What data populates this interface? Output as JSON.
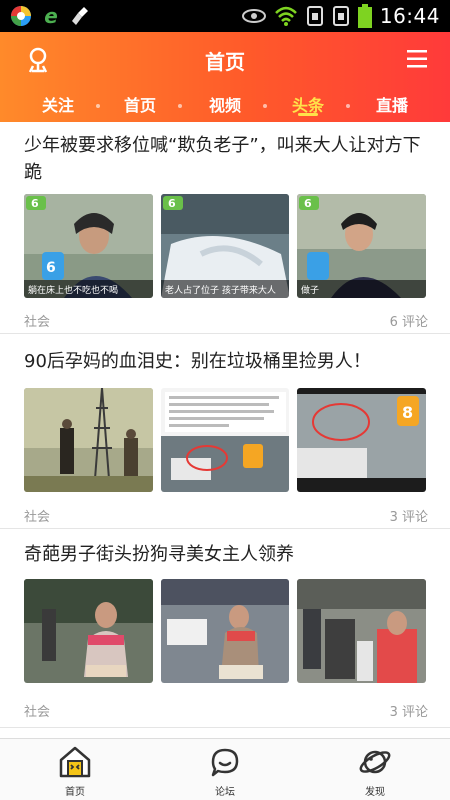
{
  "status_bar": {
    "time": "16:44",
    "icons": [
      "browser-icon",
      "edge-icon",
      "broom-icon",
      "eye-icon",
      "wifi-icon",
      "sim-icon",
      "sim-icon",
      "battery-icon"
    ]
  },
  "header": {
    "title": "首页",
    "tabs": [
      {
        "label": "关注",
        "active": false
      },
      {
        "label": "首页",
        "active": false
      },
      {
        "label": "视频",
        "active": false
      },
      {
        "label": "头条",
        "active": true
      },
      {
        "label": "直播",
        "active": false
      }
    ]
  },
  "articles": [
    {
      "title": "少年被要求移位喊“欺负老子”，叫来大人让对方下跪",
      "category": "社会",
      "comments": "6 评论",
      "thumb_captions": [
        "躺在床上也不吃也不喝",
        "老人占了位子 孩子带来大人",
        "做子"
      ]
    },
    {
      "title": "90后孕妈的血泪史：别在垃圾桶里捡男人！",
      "category": "社会",
      "comments": "3 评论",
      "thumb_captions": [
        "",
        "",
        ""
      ]
    },
    {
      "title": "奇葩男子街头扮狗寻美女主人领养",
      "category": "社会",
      "comments": "3 评论",
      "thumb_captions": [
        "",
        "",
        ""
      ]
    }
  ],
  "bottom_nav": [
    {
      "label": "首页",
      "icon": "home-icon"
    },
    {
      "label": "论坛",
      "icon": "chat-icon"
    },
    {
      "label": "发现",
      "icon": "planet-icon"
    }
  ],
  "colors": {
    "header_start": "#ff8a2a",
    "header_end": "#ff3a3a",
    "active_tab": "#ffe24a"
  }
}
